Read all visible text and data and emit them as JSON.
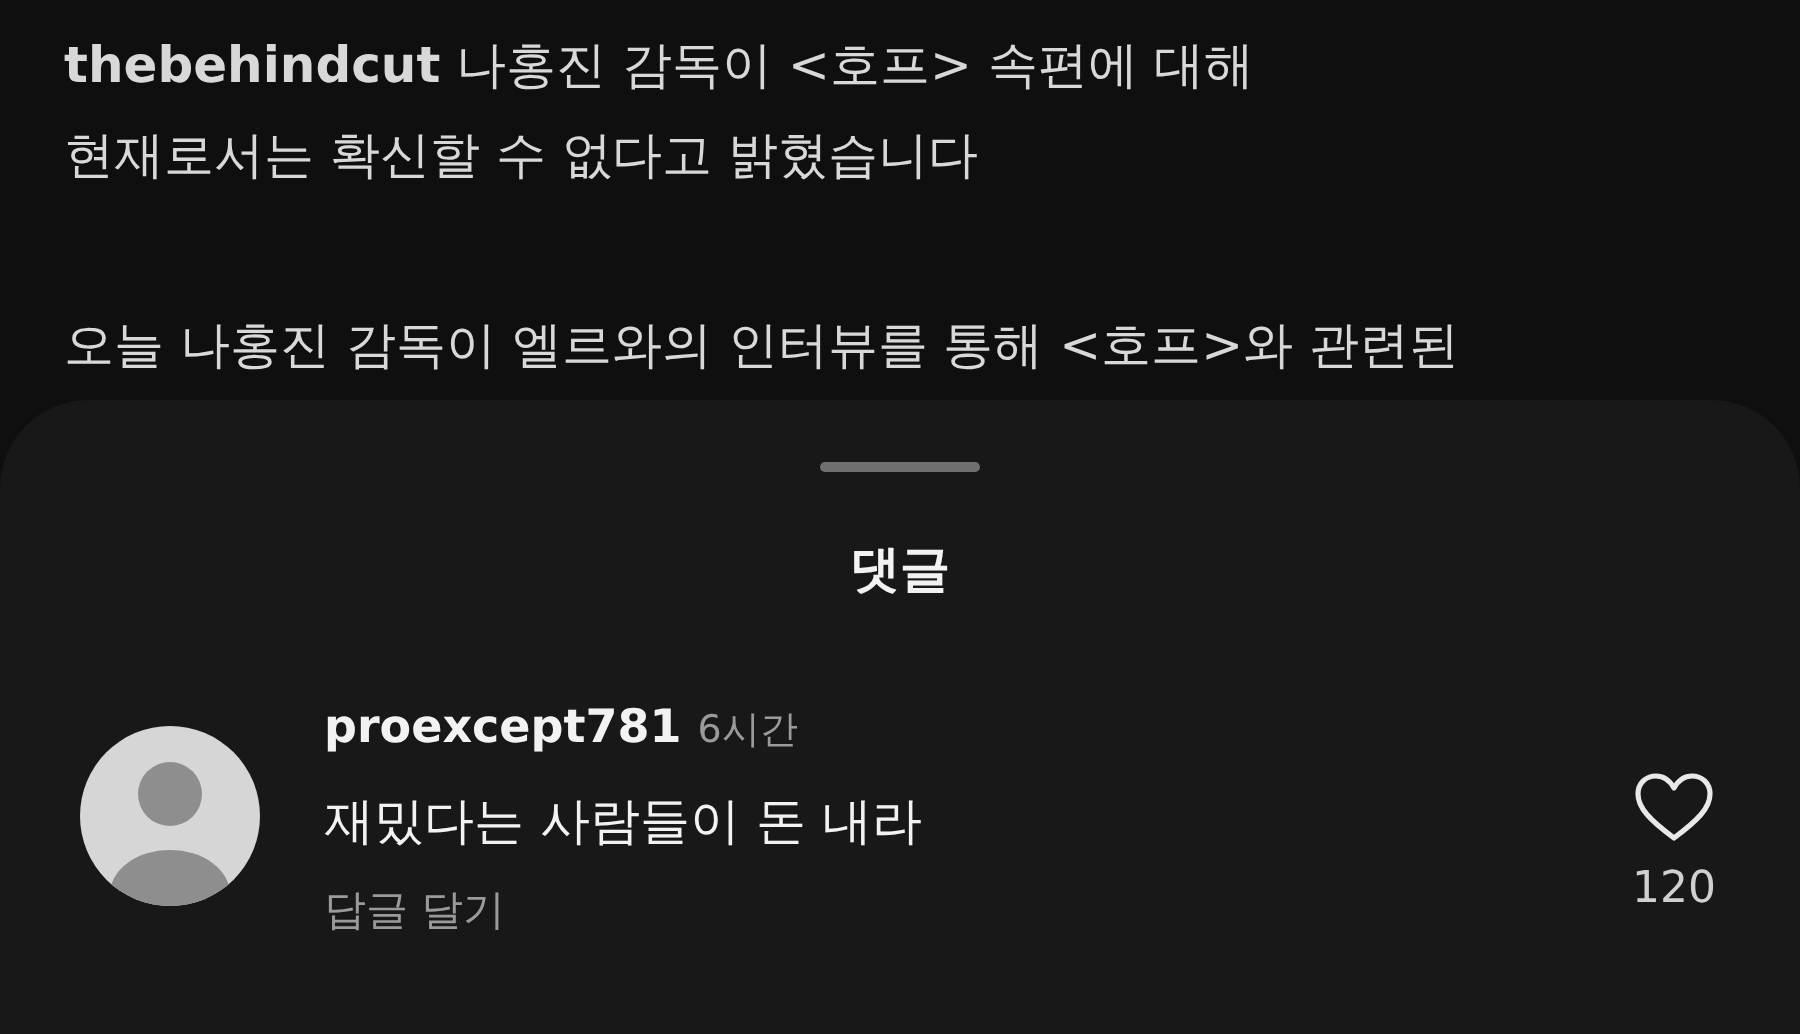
{
  "post": {
    "paragraphs": [
      "**thebehindcut** 나홍진 감독이 <호프> 속편에 대해\n현재로서는 확신할 수 없다고 밝혔습니다",
      "오늘 나홍진 감독이 엘르와의 인터뷰를 통해 <호프>와 관련된"
    ]
  },
  "sheet": {
    "title": "댓글"
  },
  "comments": [
    {
      "username": "proexcept781",
      "time": "6시간",
      "text": "재밌다는 사람들이 돈 내라",
      "reply_label": "답글 달기",
      "likes": "120",
      "liked": false
    }
  ]
}
